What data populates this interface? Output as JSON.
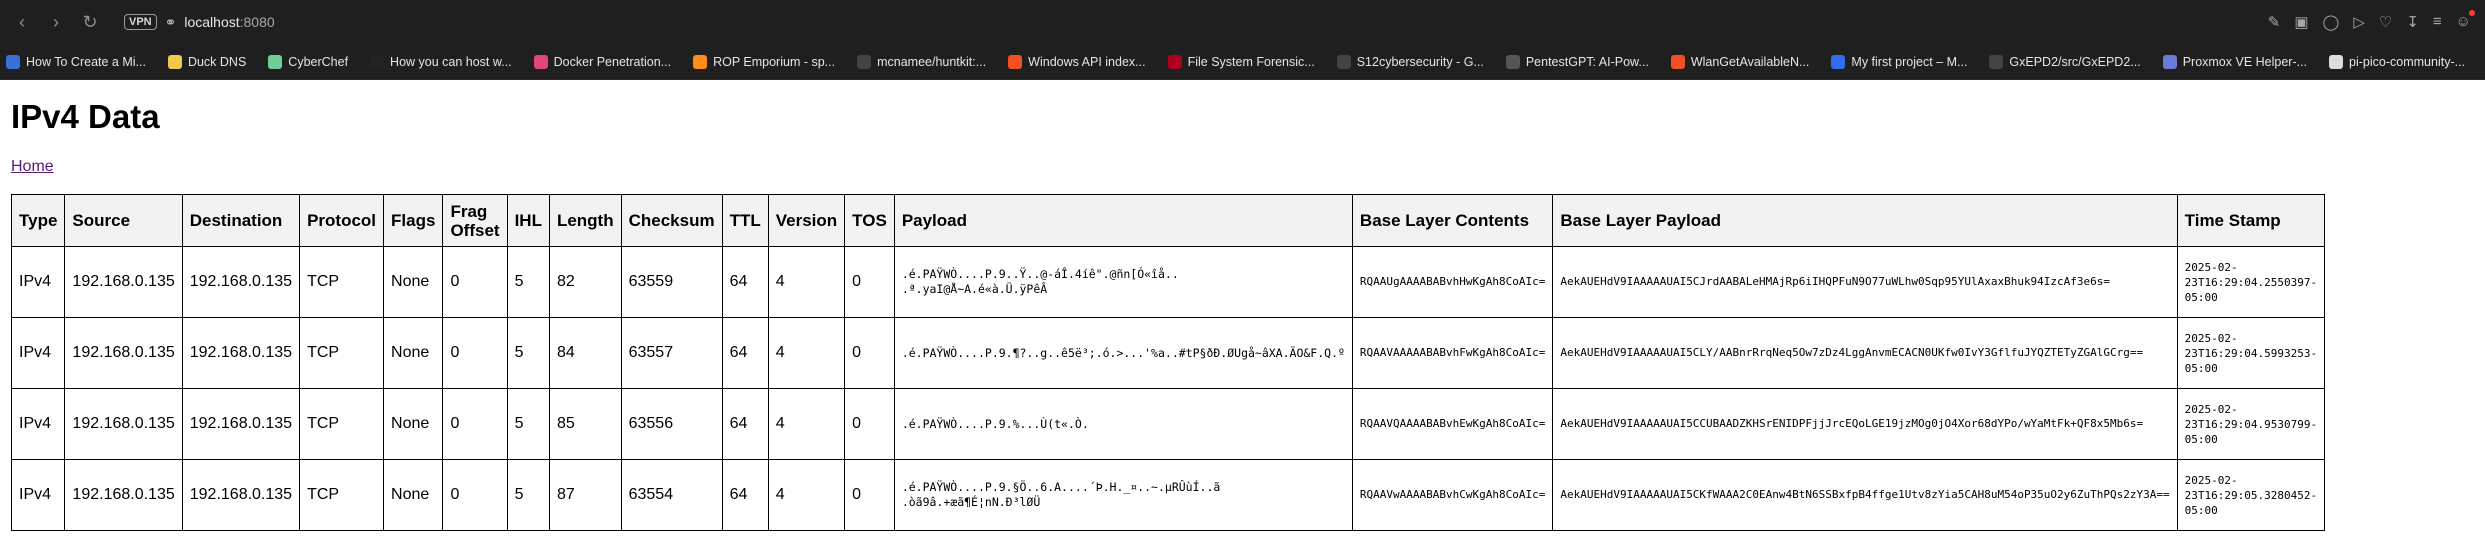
{
  "browser": {
    "vpn": "VPN",
    "url_host": "localhost",
    "url_port": ":8080"
  },
  "bookmarks": [
    {
      "label": "How To Create a Mi...",
      "color": "#3b6fd8"
    },
    {
      "label": "Duck DNS",
      "color": "#f2c94c"
    },
    {
      "label": "CyberChef",
      "color": "#6fcf97"
    },
    {
      "label": "How you can host w...",
      "color": "#222222"
    },
    {
      "label": "Docker Penetration...",
      "color": "#e0467c"
    },
    {
      "label": "ROP Emporium - sp...",
      "color": "#ff8c1a"
    },
    {
      "label": "mcnamee/huntkit:...",
      "color": "#444444"
    },
    {
      "label": "Windows API index...",
      "color": "#f25022"
    },
    {
      "label": "File System Forensic...",
      "color": "#b00020"
    },
    {
      "label": "S12cybersecurity - G...",
      "color": "#444444"
    },
    {
      "label": "PentestGPT: AI-Pow...",
      "color": "#555555"
    },
    {
      "label": "WlanGetAvailableN...",
      "color": "#f25022"
    },
    {
      "label": "My first project – M...",
      "color": "#2f6fed"
    },
    {
      "label": "GxEPD2/src/GxEPD2...",
      "color": "#444444"
    },
    {
      "label": "Proxmox VE Helper-...",
      "color": "#6a7bd8"
    },
    {
      "label": "pi-pico-community-...",
      "color": "#dddddd"
    }
  ],
  "page": {
    "title": "IPv4 Data",
    "home_link": "Home"
  },
  "table": {
    "headers": [
      "Type",
      "Source",
      "Destination",
      "Protocol",
      "Flags",
      "Frag Offset",
      "IHL",
      "Length",
      "Checksum",
      "TTL",
      "Version",
      "TOS",
      "Payload",
      "Base Layer Contents",
      "Base Layer Payload",
      "Time Stamp"
    ],
    "rows": [
      {
        "type": "IPv4",
        "source": "192.168.0.135",
        "destination": "192.168.0.135",
        "protocol": "TCP",
        "flags": "None",
        "frag_offset": "0",
        "ihl": "5",
        "length": "82",
        "checksum": "63559",
        "ttl": "64",
        "version": "4",
        "tos": "0",
        "payload": ".é.PAŸWÒ....P.9..Ÿ..@-áÎ.4íê\".@ñn[Ó«îå..\n.ª.yaI@Å~A.é«à.Ü.ÿPêÂ",
        "base_layer_contents": "RQAAUgAAAABABvhHwKgAh8CoAIc=",
        "base_layer_payload": "AekAUEHdV9IAAAAAUAI5CJrdAABALeHMAjRp6iIHQPFuN9O77uWLhw0Sqp95YUlAxaxBhuk94IzcAf3e6s=",
        "timestamp": "2025-02-\n23T16:29:04.2550397-05:00"
      },
      {
        "type": "IPv4",
        "source": "192.168.0.135",
        "destination": "192.168.0.135",
        "protocol": "TCP",
        "flags": "None",
        "frag_offset": "0",
        "ihl": "5",
        "length": "84",
        "checksum": "63557",
        "ttl": "64",
        "version": "4",
        "tos": "0",
        "payload": ".é.PAŸWÒ....P.9.¶?..g..ê5ë³;.ó.>...'%a..#tP§ðÐ.ØUgå~âXA.ÄO&F.Q.º",
        "base_layer_contents": "RQAAVAAAAABABvhFwKgAh8CoAIc=",
        "base_layer_payload": "AekAUEHdV9IAAAAAUAI5CLY/AABnrRrqNeq5Ow7zDz4LggAnvmECACN0UKfw0IvY3GflfuJYQZTETyZGAlGCrg==",
        "timestamp": "2025-02-\n23T16:29:04.5993253-05:00"
      },
      {
        "type": "IPv4",
        "source": "192.168.0.135",
        "destination": "192.168.0.135",
        "protocol": "TCP",
        "flags": "None",
        "frag_offset": "0",
        "ihl": "5",
        "length": "85",
        "checksum": "63556",
        "ttl": "64",
        "version": "4",
        "tos": "0",
        "payload": ".é.PAŸWÒ....P.9.%...Ù(t«.Ò.",
        "base_layer_contents": "RQAAVQAAAABABvhEwKgAh8CoAIc=",
        "base_layer_payload": "AekAUEHdV9IAAAAAUAI5CCUBAADZKHSrENIDPFjjJrcEQoLGE19jzMOg0jO4Xor68dYPo/wYaMtFk+QF8x5Mb6s=",
        "timestamp": "2025-02-\n23T16:29:04.9530799-05:00"
      },
      {
        "type": "IPv4",
        "source": "192.168.0.135",
        "destination": "192.168.0.135",
        "protocol": "TCP",
        "flags": "None",
        "frag_offset": "0",
        "ihl": "5",
        "length": "87",
        "checksum": "63554",
        "ttl": "64",
        "version": "4",
        "tos": "0",
        "payload": ".é.PAŸWÒ....P.9.§Ö..6.A....´Þ.H._¤..~.µRÛùÍ..ã\n.òã9â.+æã¶É¦nN.Ð³lØÜ",
        "base_layer_contents": "RQAAVwAAAABABvhCwKgAh8CoAIc=",
        "base_layer_payload": "AekAUEHdV9IAAAAAUAI5CKfWAAA2C0EAnw4BtN6SSBxfpB4ffge1Utv8zYia5CAH8uM54oP35uO2y6ZuThPQs2zY3A==",
        "timestamp": "2025-02-\n23T16:29:05.3280452-05:00"
      }
    ]
  }
}
